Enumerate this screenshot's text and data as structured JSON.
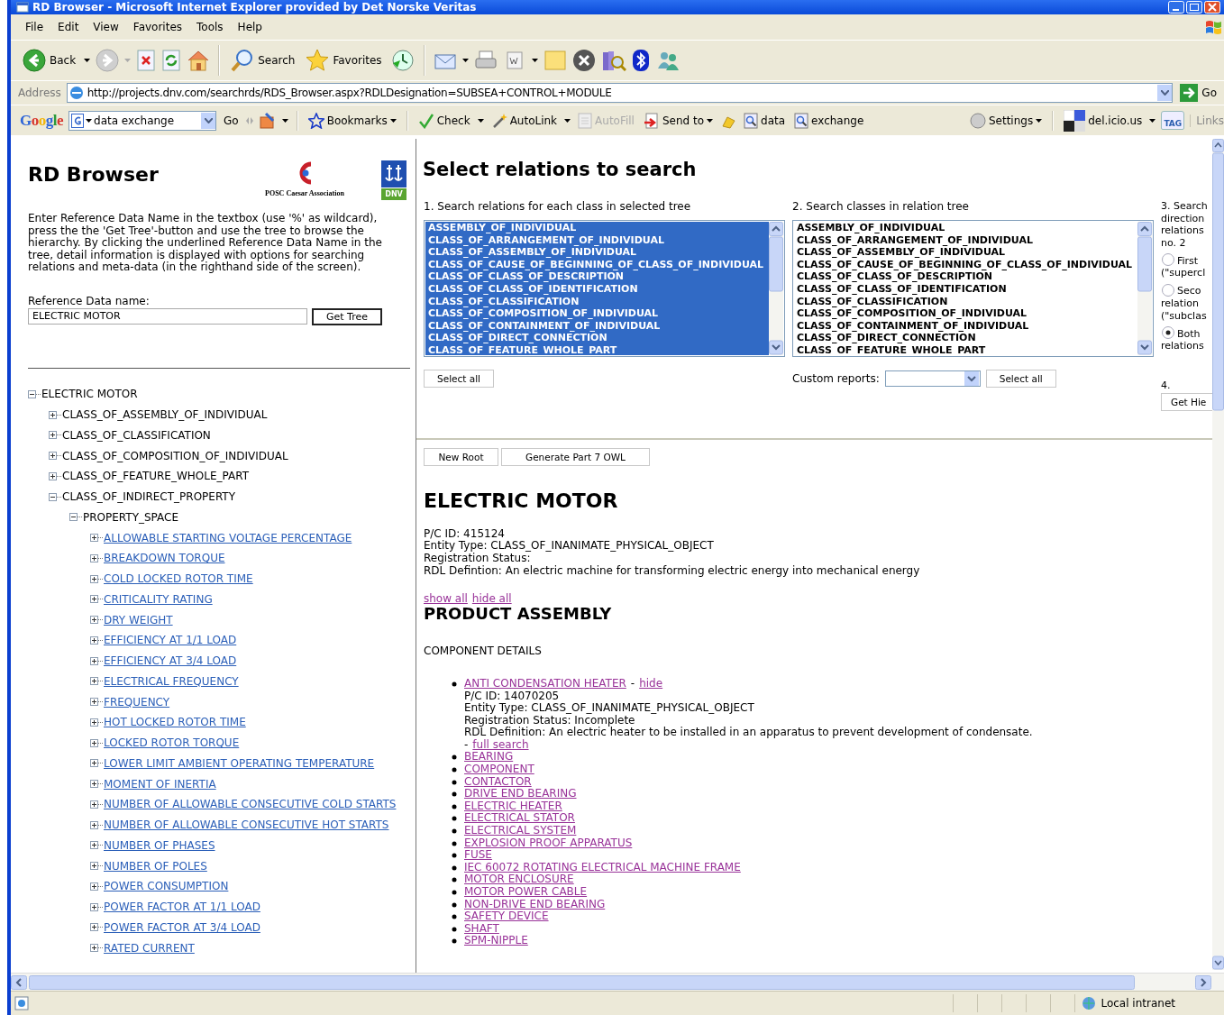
{
  "window": {
    "title": "RD Browser - Microsoft Internet Explorer provided by Det Norske Veritas"
  },
  "menu": [
    "File",
    "Edit",
    "View",
    "Favorites",
    "Tools",
    "Help"
  ],
  "toolbar": {
    "back": "Back",
    "search": "Search",
    "favorites": "Favorites"
  },
  "address": {
    "label": "Address",
    "url": "http://projects.dnv.com/searchrds/RDS_Browser.aspx?RDLDesignation=SUBSEA+CONTROL+MODULE",
    "go": "Go"
  },
  "google_bar": {
    "logo": "Google",
    "query": "data exchange",
    "go": "Go",
    "bookmarks": "Bookmarks",
    "check": "Check",
    "autolink": "AutoLink",
    "autofill": {
      "label": "AutoFill",
      "disabled": true
    },
    "send_to": "Send to",
    "data": "data",
    "exchange": "exchange",
    "settings": "Settings",
    "delicious": "del.icio.us",
    "tag": "TAG",
    "links": "Links"
  },
  "left": {
    "title": "RD Browser",
    "logo_caption": "POSC Caesar Association",
    "dnv": "DNV",
    "intro": "Enter Reference Data Name in the textbox (use '%' as wildcard), press the the 'Get Tree'-button and use the tree to browse the hierarchy. By clicking the underlined Reference Data Name in the tree, detail information is displayed with options for searching relations and meta-data (in the righthand side of the screen).",
    "ref_label": "Reference Data name:",
    "ref_value": "ELECTRIC MOTOR",
    "get_tree": "Get Tree",
    "tree": [
      {
        "label": "ELECTRIC MOTOR",
        "link": false,
        "expanded": true,
        "children": [
          {
            "label": "CLASS_OF_ASSEMBLY_OF_INDIVIDUAL",
            "link": false,
            "expanded": false
          },
          {
            "label": "CLASS_OF_CLASSIFICATION",
            "link": false,
            "expanded": false
          },
          {
            "label": "CLASS_OF_COMPOSITION_OF_INDIVIDUAL",
            "link": false,
            "expanded": false
          },
          {
            "label": "CLASS_OF_FEATURE_WHOLE_PART",
            "link": false,
            "expanded": false
          },
          {
            "label": "CLASS_OF_INDIRECT_PROPERTY",
            "link": false,
            "expanded": true,
            "children": [
              {
                "label": "PROPERTY_SPACE",
                "link": false,
                "expanded": true,
                "children": [
                  {
                    "label": "ALLOWABLE STARTING VOLTAGE PERCENTAGE",
                    "link": true,
                    "expanded": false
                  },
                  {
                    "label": "BREAKDOWN TORQUE",
                    "link": true,
                    "expanded": false
                  },
                  {
                    "label": "COLD LOCKED ROTOR TIME",
                    "link": true,
                    "expanded": false
                  },
                  {
                    "label": "CRITICALITY RATING",
                    "link": true,
                    "expanded": false
                  },
                  {
                    "label": "DRY WEIGHT",
                    "link": true,
                    "expanded": false
                  },
                  {
                    "label": "EFFICIENCY AT 1/1 LOAD",
                    "link": true,
                    "expanded": false
                  },
                  {
                    "label": "EFFICIENCY AT 3/4 LOAD",
                    "link": true,
                    "expanded": false
                  },
                  {
                    "label": "ELECTRICAL FREQUENCY",
                    "link": true,
                    "expanded": false
                  },
                  {
                    "label": "FREQUENCY",
                    "link": true,
                    "expanded": false
                  },
                  {
                    "label": "HOT LOCKED ROTOR TIME",
                    "link": true,
                    "expanded": false
                  },
                  {
                    "label": "LOCKED ROTOR TORQUE",
                    "link": true,
                    "expanded": false
                  },
                  {
                    "label": "LOWER LIMIT AMBIENT OPERATING TEMPERATURE",
                    "link": true,
                    "expanded": false
                  },
                  {
                    "label": "MOMENT OF INERTIA",
                    "link": true,
                    "expanded": false
                  },
                  {
                    "label": "NUMBER OF ALLOWABLE CONSECUTIVE COLD STARTS",
                    "link": true,
                    "expanded": false
                  },
                  {
                    "label": "NUMBER OF ALLOWABLE CONSECUTIVE HOT STARTS",
                    "link": true,
                    "expanded": false
                  },
                  {
                    "label": "NUMBER OF PHASES",
                    "link": true,
                    "expanded": false
                  },
                  {
                    "label": "NUMBER OF POLES",
                    "link": true,
                    "expanded": false
                  },
                  {
                    "label": "POWER CONSUMPTION",
                    "link": true,
                    "expanded": false
                  },
                  {
                    "label": "POWER FACTOR AT 1/1 LOAD",
                    "link": true,
                    "expanded": false
                  },
                  {
                    "label": "POWER FACTOR AT 3/4 LOAD",
                    "link": true,
                    "expanded": false
                  },
                  {
                    "label": "RATED CURRENT",
                    "link": true,
                    "expanded": false
                  }
                ]
              }
            ]
          }
        ]
      }
    ]
  },
  "right": {
    "title": "Select relations to search",
    "col1": {
      "heading": "1. Search relations for each class in selected tree",
      "button": "Select all",
      "items": [
        {
          "label": "ASSEMBLY_OF_INDIVIDUAL",
          "selected": true
        },
        {
          "label": "CLASS_OF_ARRANGEMENT_OF_INDIVIDUAL",
          "selected": true
        },
        {
          "label": "CLASS_OF_ASSEMBLY_OF_INDIVIDUAL",
          "selected": true
        },
        {
          "label": "CLASS_OF_CAUSE_OF_BEGINNING_OF_CLASS_OF_INDIVIDUAL",
          "selected": true
        },
        {
          "label": "CLASS_OF_CLASS_OF_DESCRIPTION",
          "selected": true
        },
        {
          "label": "CLASS_OF_CLASS_OF_IDENTIFICATION",
          "selected": true
        },
        {
          "label": "CLASS_OF_CLASSIFICATION",
          "selected": true
        },
        {
          "label": "CLASS_OF_COMPOSITION_OF_INDIVIDUAL",
          "selected": true
        },
        {
          "label": "CLASS_OF_CONTAINMENT_OF_INDIVIDUAL",
          "selected": true
        },
        {
          "label": "CLASS_OF_DIRECT_CONNECTION",
          "selected": true
        },
        {
          "label": "CLASS_OF_FEATURE_WHOLE_PART",
          "selected": true
        }
      ]
    },
    "col2": {
      "heading": "2. Search classes in relation tree",
      "custom_label": "Custom reports:",
      "button": "Select all",
      "items": [
        {
          "label": "ASSEMBLY_OF_INDIVIDUAL",
          "selected": false
        },
        {
          "label": "CLASS_OF_ARRANGEMENT_OF_INDIVIDUAL",
          "selected": false
        },
        {
          "label": "CLASS_OF_ASSEMBLY_OF_INDIVIDUAL",
          "selected": false
        },
        {
          "label": "CLASS_OF_CAUSE_OF_BEGINNING_OF_CLASS_OF_INDIVIDUAL",
          "selected": false
        },
        {
          "label": "CLASS_OF_CLASS_OF_DESCRIPTION",
          "selected": false
        },
        {
          "label": "CLASS_OF_CLASS_OF_IDENTIFICATION",
          "selected": false
        },
        {
          "label": "CLASS_OF_CLASSIFICATION",
          "selected": false
        },
        {
          "label": "CLASS_OF_COMPOSITION_OF_INDIVIDUAL",
          "selected": false
        },
        {
          "label": "CLASS_OF_CONTAINMENT_OF_INDIVIDUAL",
          "selected": false
        },
        {
          "label": "CLASS_OF_DIRECT_CONNECTION",
          "selected": false
        },
        {
          "label": "CLASS_OF_FEATURE_WHOLE_PART",
          "selected": false
        }
      ]
    },
    "col3": {
      "heading": [
        "3. Search",
        "direction",
        "relations",
        "no. 2"
      ],
      "options": [
        {
          "lines": [
            "First",
            "(\"supercl"
          ],
          "selected": false
        },
        {
          "lines": [
            "Seco",
            "relation",
            "(\"subclas"
          ],
          "selected": false
        },
        {
          "lines": [
            "Both",
            "relations"
          ],
          "selected": true
        }
      ],
      "step4": "4.",
      "button": "Get Hie"
    },
    "buttons": [
      "New Root",
      "Generate Part 7 OWL"
    ],
    "entity": {
      "name": "ELECTRIC MOTOR",
      "fields": [
        "P/C ID: 415124",
        "Entity Type: CLASS_OF_INANIMATE_PHYSICAL_OBJECT",
        "Registration Status:",
        "RDL Defintion: An electric machine for transforming electric energy into mechanical energy"
      ]
    },
    "show_all": "show all",
    "hide_all": "hide all",
    "section": "PRODUCT ASSEMBLY",
    "subsection": "COMPONENT DETAILS",
    "components": [
      {
        "name": "ANTI CONDENSATION HEATER",
        "expanded": true,
        "toggle_separator": "-",
        "toggle": "hide",
        "details": [
          "P/C ID: 14070205",
          "Entity Type: CLASS_OF_INANIMATE_PHYSICAL_OBJECT",
          "Registration Status: Incomplete",
          "RDL Definition: An electric heater to be installed in an apparatus to prevent development of condensate."
        ],
        "search_prefix": "-",
        "search": "full search"
      },
      {
        "name": "BEARING",
        "expanded": false
      },
      {
        "name": "COMPONENT",
        "expanded": false
      },
      {
        "name": "CONTACTOR",
        "expanded": false
      },
      {
        "name": "DRIVE END BEARING",
        "expanded": false
      },
      {
        "name": "ELECTRIC HEATER",
        "expanded": false
      },
      {
        "name": "ELECTRICAL STATOR",
        "expanded": false
      },
      {
        "name": "ELECTRICAL SYSTEM",
        "expanded": false
      },
      {
        "name": "EXPLOSION PROOF APPARATUS",
        "expanded": false
      },
      {
        "name": "FUSE",
        "expanded": false
      },
      {
        "name": "IEC 60072 ROTATING ELECTRICAL MACHINE FRAME",
        "expanded": false
      },
      {
        "name": "MOTOR ENCLOSURE",
        "expanded": false
      },
      {
        "name": "MOTOR POWER CABLE",
        "expanded": false
      },
      {
        "name": "NON-DRIVE END BEARING",
        "expanded": false
      },
      {
        "name": "SAFETY DEVICE",
        "expanded": false
      },
      {
        "name": "SHAFT",
        "expanded": false
      },
      {
        "name": "SPM-NIPPLE",
        "expanded": false
      }
    ]
  },
  "status_bar": {
    "zone": "Local intranet"
  }
}
